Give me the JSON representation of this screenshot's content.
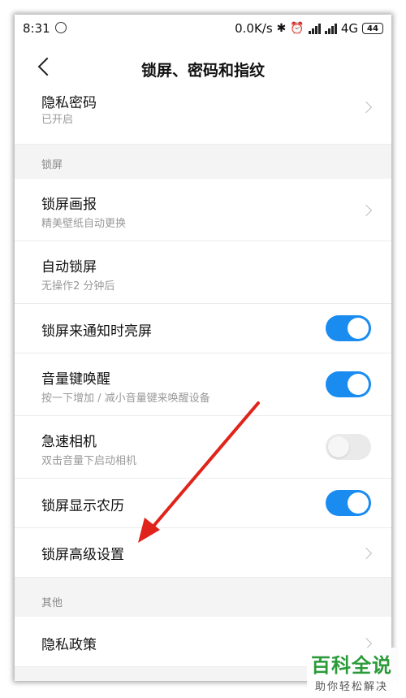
{
  "status_bar": {
    "time": "8:31",
    "speed": "0.0K/s",
    "network": "4G",
    "battery": "44"
  },
  "header": {
    "title": "锁屏、密码和指纹"
  },
  "rows": {
    "privacy_password": {
      "title": "隐私密码",
      "subtitle": "已开启"
    },
    "section_lock": "锁屏",
    "lock_wallpaper": {
      "title": "锁屏画报",
      "subtitle": "精美壁纸自动更换"
    },
    "auto_lock": {
      "title": "自动锁屏",
      "subtitle": "无操作2 分钟后"
    },
    "wake_on_notification": {
      "title": "锁屏来通知时亮屏",
      "enabled": true
    },
    "volume_wake": {
      "title": "音量键唤醒",
      "subtitle": "按一下增加 / 减小音量键来唤醒设备",
      "enabled": true
    },
    "quick_camera": {
      "title": "急速相机",
      "subtitle": "双击音量下启动相机",
      "enabled": false
    },
    "lunar_calendar": {
      "title": "锁屏显示农历",
      "enabled": true
    },
    "advanced": {
      "title": "锁屏高级设置"
    },
    "section_other": "其他",
    "privacy_policy": {
      "title": "隐私政策"
    }
  },
  "watermark": {
    "line1": "百科全说",
    "line2": "助你轻松解决"
  },
  "colors": {
    "toggle_on": "#1a8cf0",
    "annotation_arrow": "#e0241b",
    "watermark_green": "#2b9b3a"
  }
}
